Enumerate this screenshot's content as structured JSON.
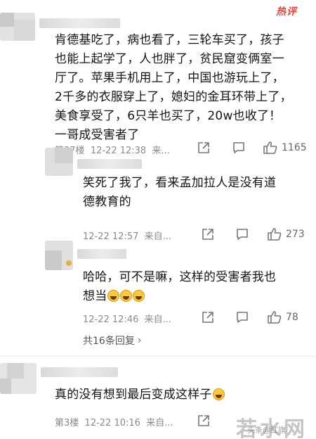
{
  "badge": "热评",
  "comments": [
    {
      "lines": [
        "肯德基吃了，病也看了，三轮车买了，孩子",
        "也能上起学了，人也胖了，贫民窟变俩室一",
        "厅了。苹果手机用上了，中国也游玩上了，",
        "2千多的衣服穿上了，媳妇的金耳环带上了，",
        "美食享受了，6只羊也买了，20w也收了！",
        "一哥成受害者了"
      ],
      "floor": "第37楼",
      "time": "12-22 12:38",
      "source": "来...",
      "likes": "1165"
    },
    {
      "lines": [
        "笑死了我了，看来孟加拉人是没有道",
        "德教育的"
      ],
      "time": "12-22 12:57",
      "source": "来自...",
      "likes": "273"
    },
    {
      "lines": [
        "哈哈，可不是嘛，这样的受害者我也",
        "想当"
      ],
      "time": "12-22 12:46",
      "source": "来自...",
      "likes": "78"
    },
    {
      "lines": [
        "真的没有想到最后变成这样子"
      ],
      "floor": "第3楼",
      "time": "12-22 10:16",
      "source": "来自..."
    }
  ],
  "replies_label": "共16条回复",
  "watermark": {
    "main": "若水网",
    "sub": "头条@红旗"
  },
  "icons": {
    "share": "share-icon",
    "comment": "comment-icon",
    "like": "thumbs-up-icon",
    "emoji": "laughing-emoji-icon",
    "chevron": "chevron-right-icon"
  }
}
